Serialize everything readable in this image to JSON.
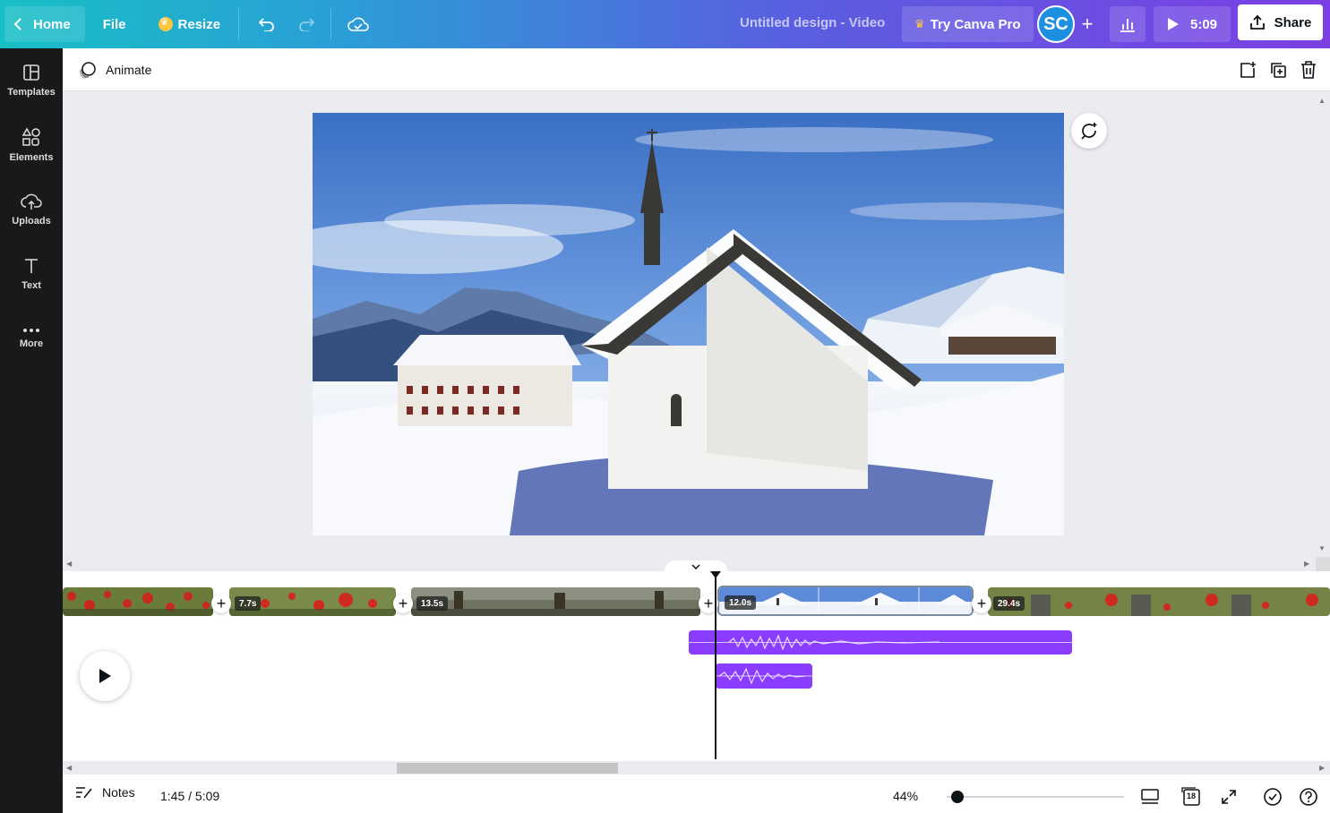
{
  "topbar": {
    "home_label": "Home",
    "file_label": "File",
    "resize_label": "Resize",
    "design_title": "Untitled design - Video",
    "try_pro_label": "Try Canva Pro",
    "avatar_initials": "SC",
    "play_duration": "5:09",
    "share_label": "Share"
  },
  "sidebar": {
    "items": [
      {
        "label": "Templates",
        "icon": "templates-icon"
      },
      {
        "label": "Elements",
        "icon": "elements-icon"
      },
      {
        "label": "Uploads",
        "icon": "uploads-icon"
      },
      {
        "label": "Text",
        "icon": "text-icon"
      },
      {
        "label": "More",
        "icon": "more-icon"
      }
    ]
  },
  "context_bar": {
    "animate_label": "Animate"
  },
  "timeline": {
    "clips": [
      {
        "label": "",
        "theme": "flowers"
      },
      {
        "label": "7.7s",
        "theme": "flowers"
      },
      {
        "label": "13.5s",
        "theme": "forest"
      },
      {
        "label": "12.0s",
        "theme": "snow",
        "selected": true
      },
      {
        "label": "29.4s",
        "theme": "flowers"
      }
    ],
    "audio_tracks": 2
  },
  "footer": {
    "notes_label": "Notes",
    "time_readout": "1:45 / 5:09",
    "zoom_level": "44%",
    "zoom_value": 0.06,
    "page_count": "18"
  },
  "colors": {
    "accent_purple": "#8b3dff",
    "gradient_start": "#18bfc6",
    "gradient_end": "#7b3fe4",
    "sidebar_bg": "#18191b"
  }
}
